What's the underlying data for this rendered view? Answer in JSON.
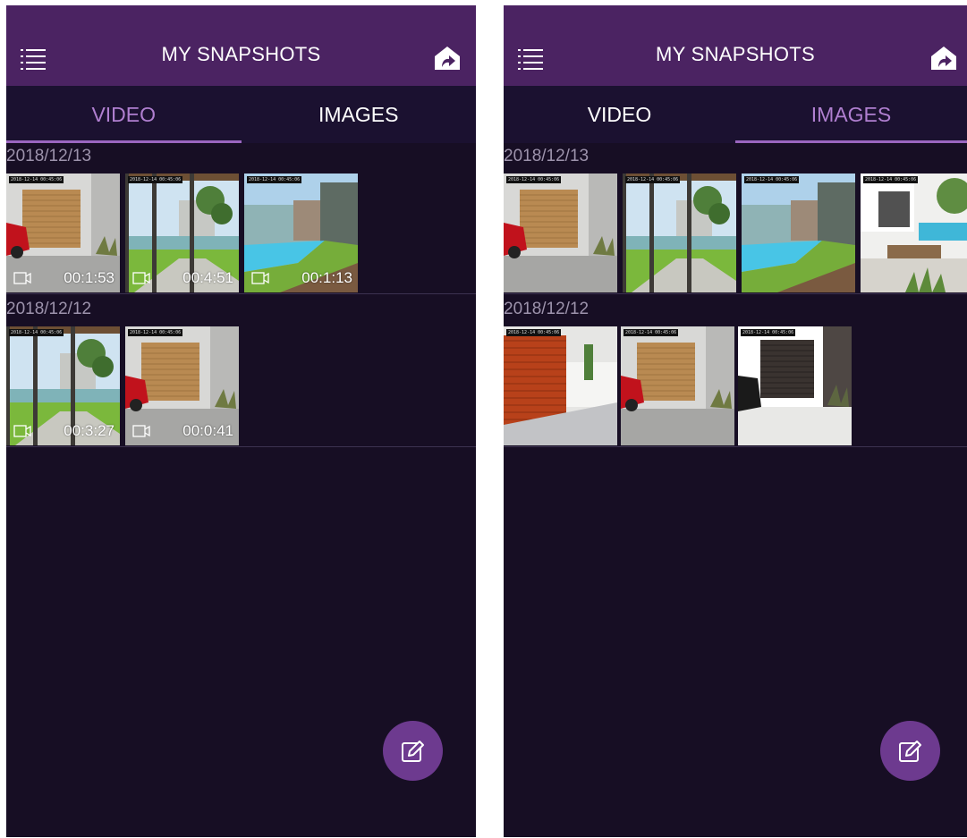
{
  "colors": {
    "appbar": "#4b2362",
    "background": "#170e24",
    "tab_bar": "#1b1130",
    "tab_active": "#b07fd0",
    "fab": "#6d3a8f",
    "date_text": "#9d93ac"
  },
  "icons": {
    "menu": "menu-icon",
    "home": "home-icon",
    "camera": "video-camera-icon",
    "edit": "edit-icon"
  },
  "screens": [
    {
      "title": "MY SNAPSHOTS",
      "tabs": [
        {
          "label": "VIDEO",
          "active": true
        },
        {
          "label": "IMAGES",
          "active": false
        }
      ],
      "sections": [
        {
          "date": "2018/12/13",
          "items": [
            {
              "scene": "garage",
              "stamp": "2018-12-14 00:45:06",
              "duration": "00:1:53"
            },
            {
              "scene": "pergola",
              "stamp": "2018-12-14 00:45:06",
              "duration": "00:4:51"
            },
            {
              "scene": "pool",
              "stamp": "2018-12-14 00:45:06",
              "duration": "00:1:13"
            }
          ]
        },
        {
          "date": "2018/12/12",
          "items": [
            {
              "scene": "pergola",
              "stamp": "2018-12-14 00:45:06",
              "duration": "00:3:27"
            },
            {
              "scene": "garage",
              "stamp": "2018-12-14 00:45:06",
              "duration": "00:0:41"
            }
          ]
        }
      ]
    },
    {
      "title": "MY SNAPSHOTS",
      "tabs": [
        {
          "label": "VIDEO",
          "active": false
        },
        {
          "label": "IMAGES",
          "active": true
        }
      ],
      "sections": [
        {
          "date": "2018/12/13",
          "items": [
            {
              "scene": "garage",
              "stamp": "2018-12-14 00:45:06"
            },
            {
              "scene": "pergola",
              "stamp": "2018-12-14 00:45:06"
            },
            {
              "scene": "pool",
              "stamp": "2018-12-14 00:45:06"
            },
            {
              "scene": "patio",
              "stamp": "2018-12-14 00:45:06"
            }
          ]
        },
        {
          "date": "2018/12/12",
          "items": [
            {
              "scene": "redgarage",
              "stamp": "2018-12-14 00:45:06"
            },
            {
              "scene": "garage",
              "stamp": "2018-12-14 00:45:06"
            },
            {
              "scene": "darkgarage",
              "stamp": "2018-12-14 00:45:06"
            }
          ]
        }
      ]
    }
  ]
}
